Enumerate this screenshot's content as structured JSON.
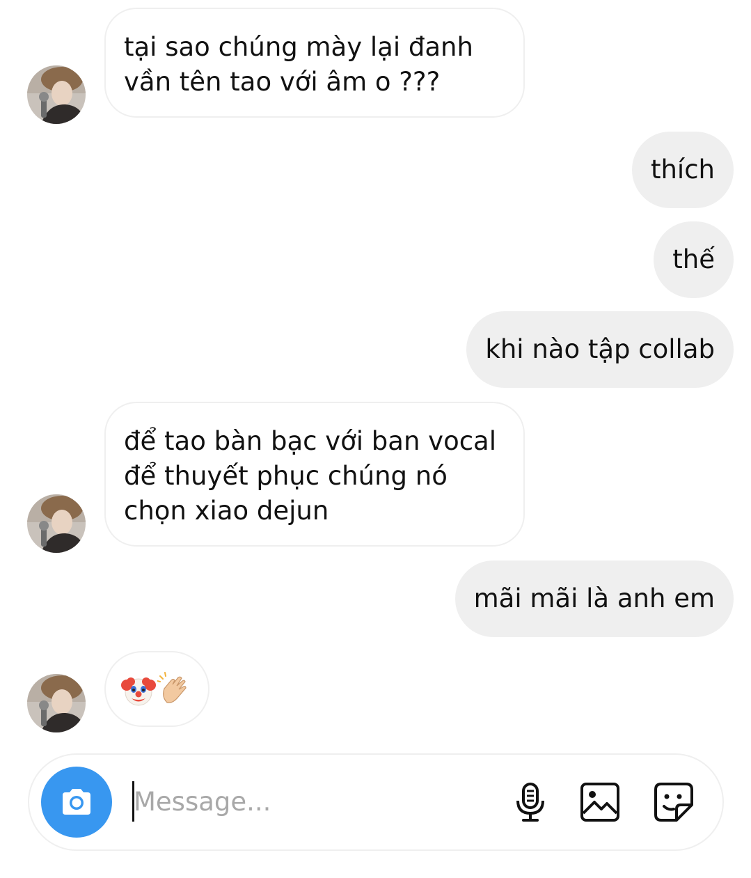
{
  "conversation": {
    "messages": [
      {
        "sender": "them",
        "text_lines": [
          "tại sao chúng mày lại đanh",
          "vần tên tao với âm o ???"
        ]
      },
      {
        "sender": "me",
        "text": "thích"
      },
      {
        "sender": "me",
        "text": "thế"
      },
      {
        "sender": "me",
        "text": "khi nào tập collab"
      },
      {
        "sender": "them",
        "text_lines": [
          "để tao bàn bạc với ban vocal",
          "để thuyết phục chúng nó",
          "chọn xiao dejun"
        ]
      },
      {
        "sender": "me",
        "text": "mãi mãi là anh em"
      },
      {
        "sender": "them",
        "emojis": [
          "clown-face",
          "clapping-hands"
        ]
      }
    ]
  },
  "composer": {
    "placeholder": "Message...",
    "value": "",
    "icons": [
      "camera-icon",
      "microphone-icon",
      "image-icon",
      "sticker-icon"
    ]
  },
  "colors": {
    "outgoing_bubble": "#efefef",
    "incoming_border": "#efefef",
    "camera_button": "#3897f0",
    "placeholder": "#a8a8a8"
  }
}
